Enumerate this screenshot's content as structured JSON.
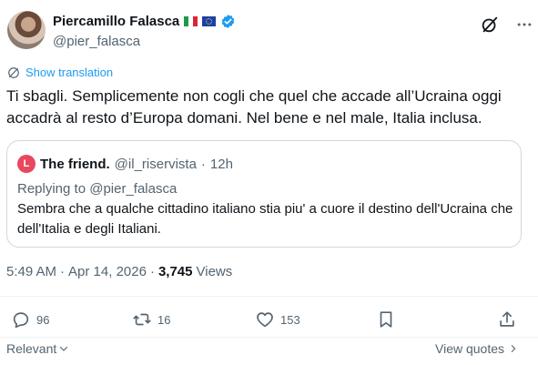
{
  "author": {
    "name": "Piercamillo Falasca",
    "handle": "@pier_falasca"
  },
  "translation": {
    "label": "Show translation"
  },
  "tweet": {
    "text": "Ti sbagli. Semplicemente non cogli che quel che accade all’Ucraina oggi accadrà al resto d’Europa domani. Nel bene e nel male, Italia inclusa."
  },
  "quote": {
    "avatar_letter": "L",
    "name": "The friend.",
    "handle": "@il_riservista",
    "separator": "·",
    "time": "12h",
    "reply_prefix": "Replying to",
    "reply_handle": "@pier_falasca",
    "text": "Sembra che a qualche cittadino italiano stia piu' a cuore il destino dell'Ucraina che dell'Italia e degli Italiani."
  },
  "meta": {
    "time": "5:49 AM",
    "separator1": "·",
    "date": "Apr 14, 2026",
    "separator2": "·",
    "views_count": "3,745",
    "views_label": "Views"
  },
  "actions": {
    "replies": "96",
    "reposts": "16",
    "likes": "153"
  },
  "footer": {
    "sort_label": "Relevant",
    "view_quotes": "View quotes"
  },
  "icons": {
    "grok": "grok-slash-circle-icon",
    "more": "more-dots-icon",
    "translate": "globe-translate-icon",
    "reply": "reply-bubble-icon",
    "repost": "repost-arrows-icon",
    "like": "heart-icon",
    "bookmark": "bookmark-icon",
    "share": "share-upload-icon",
    "verified": "verified-badge-icon"
  },
  "colors": {
    "accent": "#1d9bf0",
    "text": "#0f1419",
    "muted": "#536471",
    "border": "#cfd9de"
  }
}
